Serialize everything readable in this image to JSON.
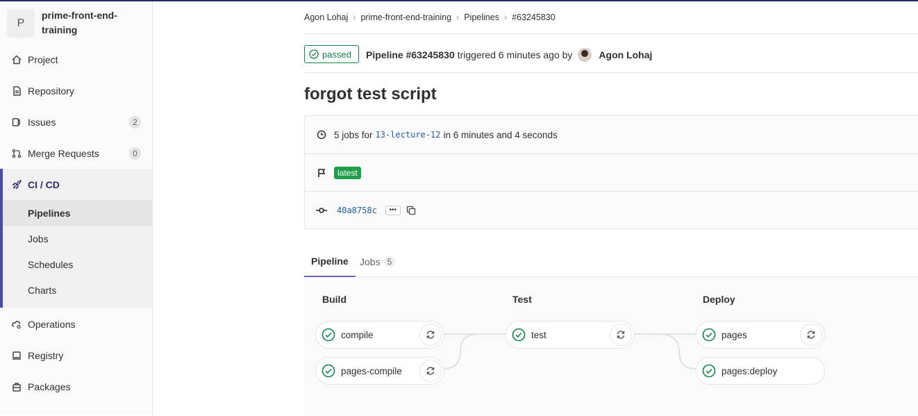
{
  "project": {
    "avatar_letter": "P",
    "name": "prime-front-end-training"
  },
  "sidebar": {
    "items": [
      {
        "label": "Project",
        "icon": "home-icon"
      },
      {
        "label": "Repository",
        "icon": "doc-icon"
      },
      {
        "label": "Issues",
        "icon": "issues-icon",
        "count": "2"
      },
      {
        "label": "Merge Requests",
        "icon": "merge-request-icon",
        "count": "0"
      }
    ],
    "cicd": {
      "label": "CI / CD",
      "sub": [
        "Pipelines",
        "Jobs",
        "Schedules",
        "Charts"
      ]
    },
    "bottom_items": [
      {
        "label": "Operations",
        "icon": "cloud-gear-icon"
      },
      {
        "label": "Registry",
        "icon": "container-icon"
      },
      {
        "label": "Packages",
        "icon": "package-icon"
      }
    ]
  },
  "breadcrumb": [
    "Agon Lohaj",
    "prime-front-end-training",
    "Pipelines",
    "#63245830"
  ],
  "pipeline": {
    "status": "passed",
    "label": "Pipeline #63245830",
    "triggered_text": "triggered 6 minutes ago by",
    "user": "Agon Lohaj",
    "title": "forgot test script",
    "jobs_prefix": "5 jobs for",
    "branch": "13-lecture-12",
    "duration_text": "in 6 minutes and 4 seconds",
    "tag": "latest",
    "commit": "40a8758c",
    "ellipsis": "•••"
  },
  "tabs": [
    {
      "label": "Pipeline"
    },
    {
      "label": "Jobs",
      "count": "5"
    }
  ],
  "stages": [
    {
      "name": "Build",
      "jobs": [
        "compile",
        "pages-compile"
      ]
    },
    {
      "name": "Test",
      "jobs": [
        "test"
      ]
    },
    {
      "name": "Deploy",
      "jobs": [
        "pages",
        "pages:deploy"
      ]
    }
  ],
  "colors": {
    "success": "#108548",
    "accent": "#6666c4",
    "sidebar_active": "#4b4ba3"
  }
}
